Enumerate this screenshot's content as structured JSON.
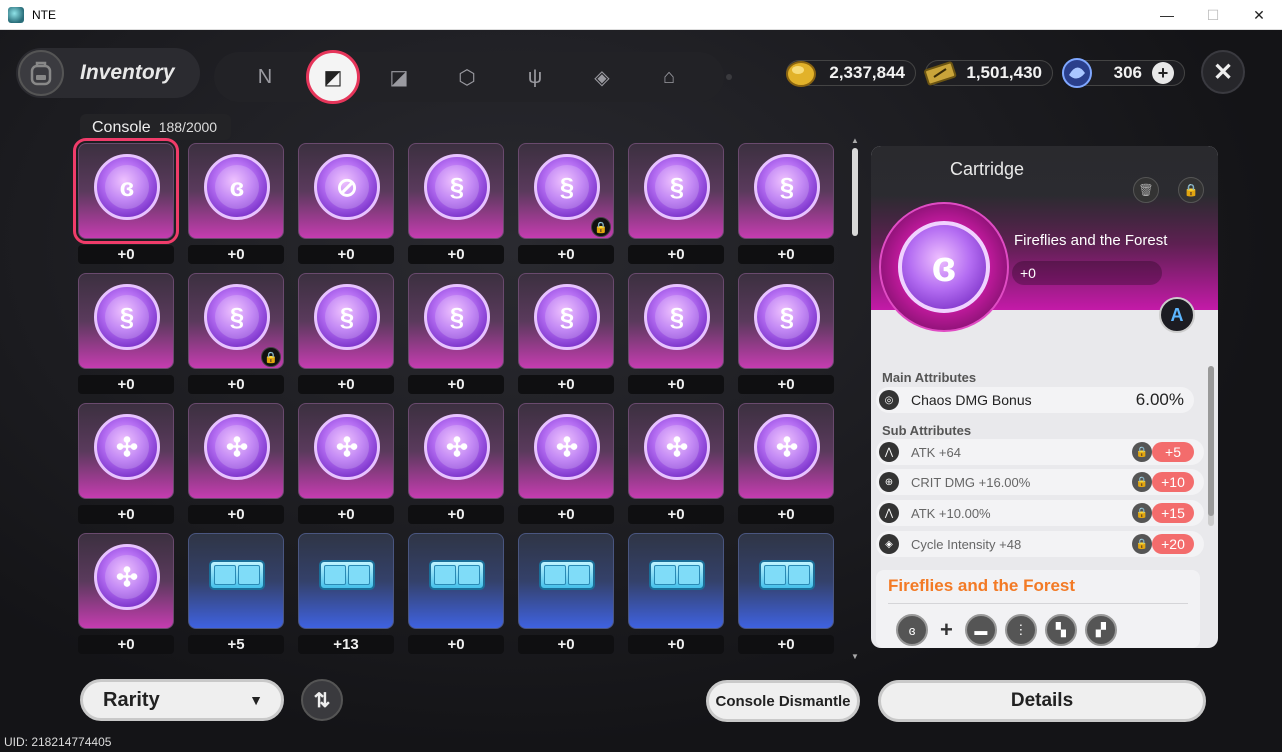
{
  "window": {
    "title": "NTE",
    "minimize": "—",
    "maximize": "☐",
    "close": "✕"
  },
  "header": {
    "title": "Inventory",
    "tabs": [
      {
        "icon": "n-logo-icon",
        "glyph": "N"
      },
      {
        "icon": "cartridge-tab-icon",
        "glyph": "◩",
        "active": true
      },
      {
        "icon": "disc-tab-icon",
        "glyph": "◪"
      },
      {
        "icon": "cube-tab-icon",
        "glyph": "⬡"
      },
      {
        "icon": "fork-knife-icon",
        "glyph": "ψ"
      },
      {
        "icon": "box-tab-icon",
        "glyph": "◈"
      },
      {
        "icon": "house-tab-icon",
        "glyph": "⌂"
      }
    ],
    "currencies": {
      "gold": "2,337,844",
      "ticket": "1,501,430",
      "crystal": "306",
      "add": "+"
    },
    "close": "✕"
  },
  "console": {
    "label": "Console",
    "count": "188/2000"
  },
  "grid": {
    "items": [
      {
        "kind": "orb",
        "glyph": "ɞ",
        "level": "+0",
        "selected": true
      },
      {
        "kind": "orb",
        "glyph": "ɞ",
        "level": "+0"
      },
      {
        "kind": "orb",
        "glyph": "⊘",
        "level": "+0"
      },
      {
        "kind": "orb",
        "glyph": "§",
        "level": "+0"
      },
      {
        "kind": "orb",
        "glyph": "§",
        "level": "+0",
        "locked": true
      },
      {
        "kind": "orb",
        "glyph": "§",
        "level": "+0"
      },
      {
        "kind": "orb",
        "glyph": "§",
        "level": "+0"
      },
      {
        "kind": "orb",
        "glyph": "§",
        "level": "+0"
      },
      {
        "kind": "orb",
        "glyph": "§",
        "level": "+0",
        "locked": true
      },
      {
        "kind": "orb",
        "glyph": "§",
        "level": "+0"
      },
      {
        "kind": "orb",
        "glyph": "§",
        "level": "+0"
      },
      {
        "kind": "orb",
        "glyph": "§",
        "level": "+0"
      },
      {
        "kind": "orb",
        "glyph": "§",
        "level": "+0"
      },
      {
        "kind": "orb",
        "glyph": "§",
        "level": "+0"
      },
      {
        "kind": "orb",
        "glyph": "✣",
        "level": "+0"
      },
      {
        "kind": "orb",
        "glyph": "✣",
        "level": "+0"
      },
      {
        "kind": "orb",
        "glyph": "✣",
        "level": "+0"
      },
      {
        "kind": "orb",
        "glyph": "✣",
        "level": "+0"
      },
      {
        "kind": "orb",
        "glyph": "✣",
        "level": "+0"
      },
      {
        "kind": "orb",
        "glyph": "✣",
        "level": "+0"
      },
      {
        "kind": "orb",
        "glyph": "✣",
        "level": "+0"
      },
      {
        "kind": "orb",
        "glyph": "✣",
        "level": "+0"
      },
      {
        "kind": "chip",
        "level": "+5"
      },
      {
        "kind": "chip",
        "level": "+13"
      },
      {
        "kind": "chip",
        "level": "+0"
      },
      {
        "kind": "chip",
        "level": "+0"
      },
      {
        "kind": "chip",
        "level": "+0"
      },
      {
        "kind": "chip",
        "level": "+0"
      }
    ]
  },
  "controls": {
    "rarity": "Rarity",
    "rarity_caret": "▼",
    "sort": "⇅",
    "dismantle": "Console Dismantle",
    "details": "Details",
    "uid": "UID: 218214774405"
  },
  "detail": {
    "type": "Cartridge",
    "name": "Fireflies and the Forest",
    "level": "+0",
    "rank": "A",
    "orb_glyph": "ɞ",
    "main_title": "Main Attributes",
    "main": {
      "name": "Chaos DMG Bonus",
      "value": "6.00%"
    },
    "sub_title": "Sub Attributes",
    "subs": [
      {
        "name": "ATK +64",
        "bonus": "+5"
      },
      {
        "name": "CRIT DMG +16.00%",
        "bonus": "+10"
      },
      {
        "name": "ATK +10.00%",
        "bonus": "+15"
      },
      {
        "name": "Cycle Intensity +48",
        "bonus": "+20"
      }
    ],
    "set_title": "Fireflies and the Forest",
    "set_plus": "+",
    "set_glyphs": [
      "ɞ",
      "▬",
      "⋮",
      "▚",
      "▞"
    ]
  }
}
